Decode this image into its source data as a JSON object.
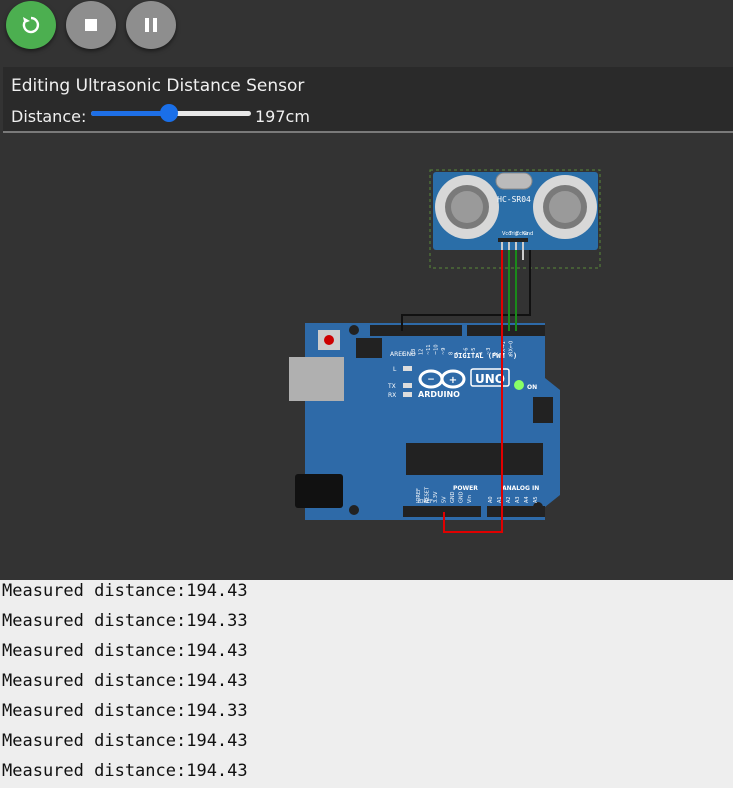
{
  "toolbar": {
    "buttons": [
      {
        "name": "restart",
        "icon": "restart-icon"
      },
      {
        "name": "stop",
        "icon": "stop-icon"
      },
      {
        "name": "pause",
        "icon": "pause-icon"
      }
    ]
  },
  "editor": {
    "title": "Editing Ultrasonic Distance Sensor",
    "distance_label": "Distance:",
    "distance_value": "197cm",
    "slider": {
      "value": 197,
      "min": 2,
      "max": 400
    }
  },
  "sensor": {
    "model": "HC-SR04",
    "pins": [
      "Vcc",
      "Trig",
      "Echo",
      "Gnd"
    ]
  },
  "arduino": {
    "brand": "ARDUINO",
    "model": "UNO",
    "on_label": "ON",
    "digital_label": "DIGITAL (PWM ~)",
    "power_label": "POWER",
    "analog_label": "ANALOG IN",
    "aref": "AREF",
    "gnd": "GND",
    "l_label": "L",
    "tx_label": "TX",
    "rx_label": "RX",
    "digital_pins": [
      "13",
      "12",
      "~11",
      "~10",
      "~9",
      "8",
      "7",
      "~6",
      "~5",
      "4",
      "~3",
      "2",
      "TX→1",
      "RX←0"
    ],
    "power_pins": [
      "IOREF",
      "RESET",
      "3.3V",
      "5V",
      "GND",
      "GND",
      "Vin"
    ],
    "analog_pins": [
      "A0",
      "A1",
      "A2",
      "A3",
      "A4",
      "A5"
    ]
  },
  "colors": {
    "board": "#2e6aa8",
    "restart": "#4caf50",
    "control": "#8e8e8e",
    "slider": "#1a6fe8",
    "wire_red": "#e00000",
    "wire_green": "#1a8a1a",
    "wire_black": "#111111"
  },
  "serial_monitor": {
    "lines": [
      "Measured distance:194.43",
      "Measured distance:194.33",
      "Measured distance:194.43",
      "Measured distance:194.43",
      "Measured distance:194.33",
      "Measured distance:194.43",
      "Measured distance:194.43"
    ]
  }
}
